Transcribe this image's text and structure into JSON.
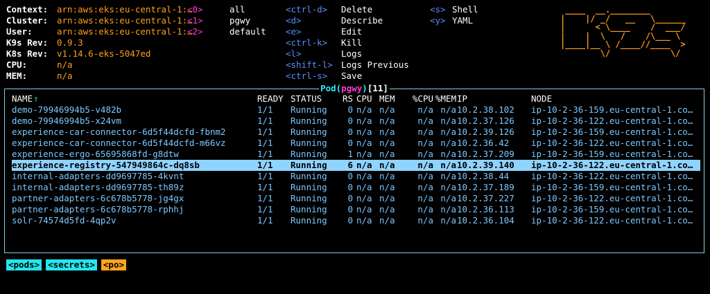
{
  "info": {
    "context_label": "Context:",
    "context_value": "arn:aws:eks:eu-central-1:…",
    "cluster_label": "Cluster:",
    "cluster_value": "arn:aws:eks:eu-central-1:…",
    "user_label": "User:",
    "user_value": "arn:aws:eks:eu-central-1:…",
    "k9s_rev_label": "K9s Rev:",
    "k9s_rev_value": "0.9.3",
    "k8s_rev_label": "K8s Rev:",
    "k8s_rev_value": "v1.14.6-eks-5047ed",
    "cpu_label": "CPU:",
    "cpu_value": "n/a",
    "mem_label": "MEM:",
    "mem_value": "n/a"
  },
  "namespaces": [
    {
      "key": "<0>",
      "name": "all"
    },
    {
      "key": "<1>",
      "name": "pgwy"
    },
    {
      "key": "<2>",
      "name": "default"
    }
  ],
  "shortcuts": [
    {
      "key": "<ctrl-d>",
      "label": "Delete"
    },
    {
      "key": "<d>",
      "label": "Describe"
    },
    {
      "key": "<e>",
      "label": "Edit"
    },
    {
      "key": "<ctrl-k>",
      "label": "Kill"
    },
    {
      "key": "<l>",
      "label": "Logs"
    },
    {
      "key": "<shift-l>",
      "label": "Logs Previous"
    },
    {
      "key": "<ctrl-s>",
      "label": "Save"
    }
  ],
  "shortcuts2": [
    {
      "key": "<s>",
      "label": "Shell"
    },
    {
      "key": "<y>",
      "label": "YAML"
    }
  ],
  "logo": " ____  __.________       \n|    |/ _/   __   \\______\n|      < \\____    /  ___/\n|    |  \\   /    /\\___ \\ \n|____|__ \\ /____//____  >\n        \\/            \\/ ",
  "panel": {
    "resource": "Pod(",
    "namespace": "pgwy",
    "close": ")",
    "count": "[11]"
  },
  "table": {
    "headers": [
      "NAME",
      "READY",
      "STATUS",
      "RS",
      "CPU",
      "MEM",
      "%CPU",
      "%MEM",
      "IP",
      "NODE"
    ],
    "sort_arrow": "↑",
    "rows": [
      [
        "demo-79946994b5-v482b",
        "1/1",
        "Running",
        "0",
        "n/a",
        "n/a",
        "n/a",
        "n/a",
        "10.2.38.102",
        "ip-10-2-36-159.eu-central-1.co…"
      ],
      [
        "demo-79946994b5-x24vm",
        "1/1",
        "Running",
        "0",
        "n/a",
        "n/a",
        "n/a",
        "n/a",
        "10.2.37.126",
        "ip-10-2-36-122.eu-central-1.co…"
      ],
      [
        "experience-car-connector-6d5f44dcfd-fbnm2",
        "1/1",
        "Running",
        "0",
        "n/a",
        "n/a",
        "n/a",
        "n/a",
        "10.2.39.126",
        "ip-10-2-36-159.eu-central-1.co…"
      ],
      [
        "experience-car-connector-6d5f44dcfd-m66vz",
        "1/1",
        "Running",
        "0",
        "n/a",
        "n/a",
        "n/a",
        "n/a",
        "10.2.36.42",
        "ip-10-2-36-122.eu-central-1.co…"
      ],
      [
        "experience-ergo-65695868fd-g8dtw",
        "1/1",
        "Running",
        "1",
        "n/a",
        "n/a",
        "n/a",
        "n/a",
        "10.2.37.209",
        "ip-10-2-36-159.eu-central-1.co…"
      ],
      [
        "experience-registry-547949864c-dq8sb",
        "1/1",
        "Running",
        "6",
        "n/a",
        "n/a",
        "n/a",
        "n/a",
        "10.2.39.140",
        "ip-10-2-36-122.eu-central-1.co…"
      ],
      [
        "internal-adapters-dd9697785-4kvnt",
        "1/1",
        "Running",
        "0",
        "n/a",
        "n/a",
        "n/a",
        "n/a",
        "10.2.38.44",
        "ip-10-2-36-122.eu-central-1.co…"
      ],
      [
        "internal-adapters-dd9697785-th89z",
        "1/1",
        "Running",
        "0",
        "n/a",
        "n/a",
        "n/a",
        "n/a",
        "10.2.37.189",
        "ip-10-2-36-159.eu-central-1.co…"
      ],
      [
        "partner-adapters-6c678b5778-jg4gx",
        "1/1",
        "Running",
        "0",
        "n/a",
        "n/a",
        "n/a",
        "n/a",
        "10.2.37.227",
        "ip-10-2-36-122.eu-central-1.co…"
      ],
      [
        "partner-adapters-6c678b5778-rphhj",
        "1/1",
        "Running",
        "0",
        "n/a",
        "n/a",
        "n/a",
        "n/a",
        "10.2.36.113",
        "ip-10-2-36-159.eu-central-1.co…"
      ],
      [
        "solr-74574d5fd-4qp2v",
        "1/1",
        "Running",
        "0",
        "n/a",
        "n/a",
        "n/a",
        "n/a",
        "10.2.36.104",
        "ip-10-2-36-122.eu-central-1.co…"
      ]
    ],
    "selected_row": 5
  },
  "breadcrumbs": [
    {
      "label": "<pods>",
      "color": "#22e6ee"
    },
    {
      "label": "<secrets>",
      "color": "#22e6ee"
    },
    {
      "label": "<po>",
      "color": "#ffa41c"
    }
  ]
}
